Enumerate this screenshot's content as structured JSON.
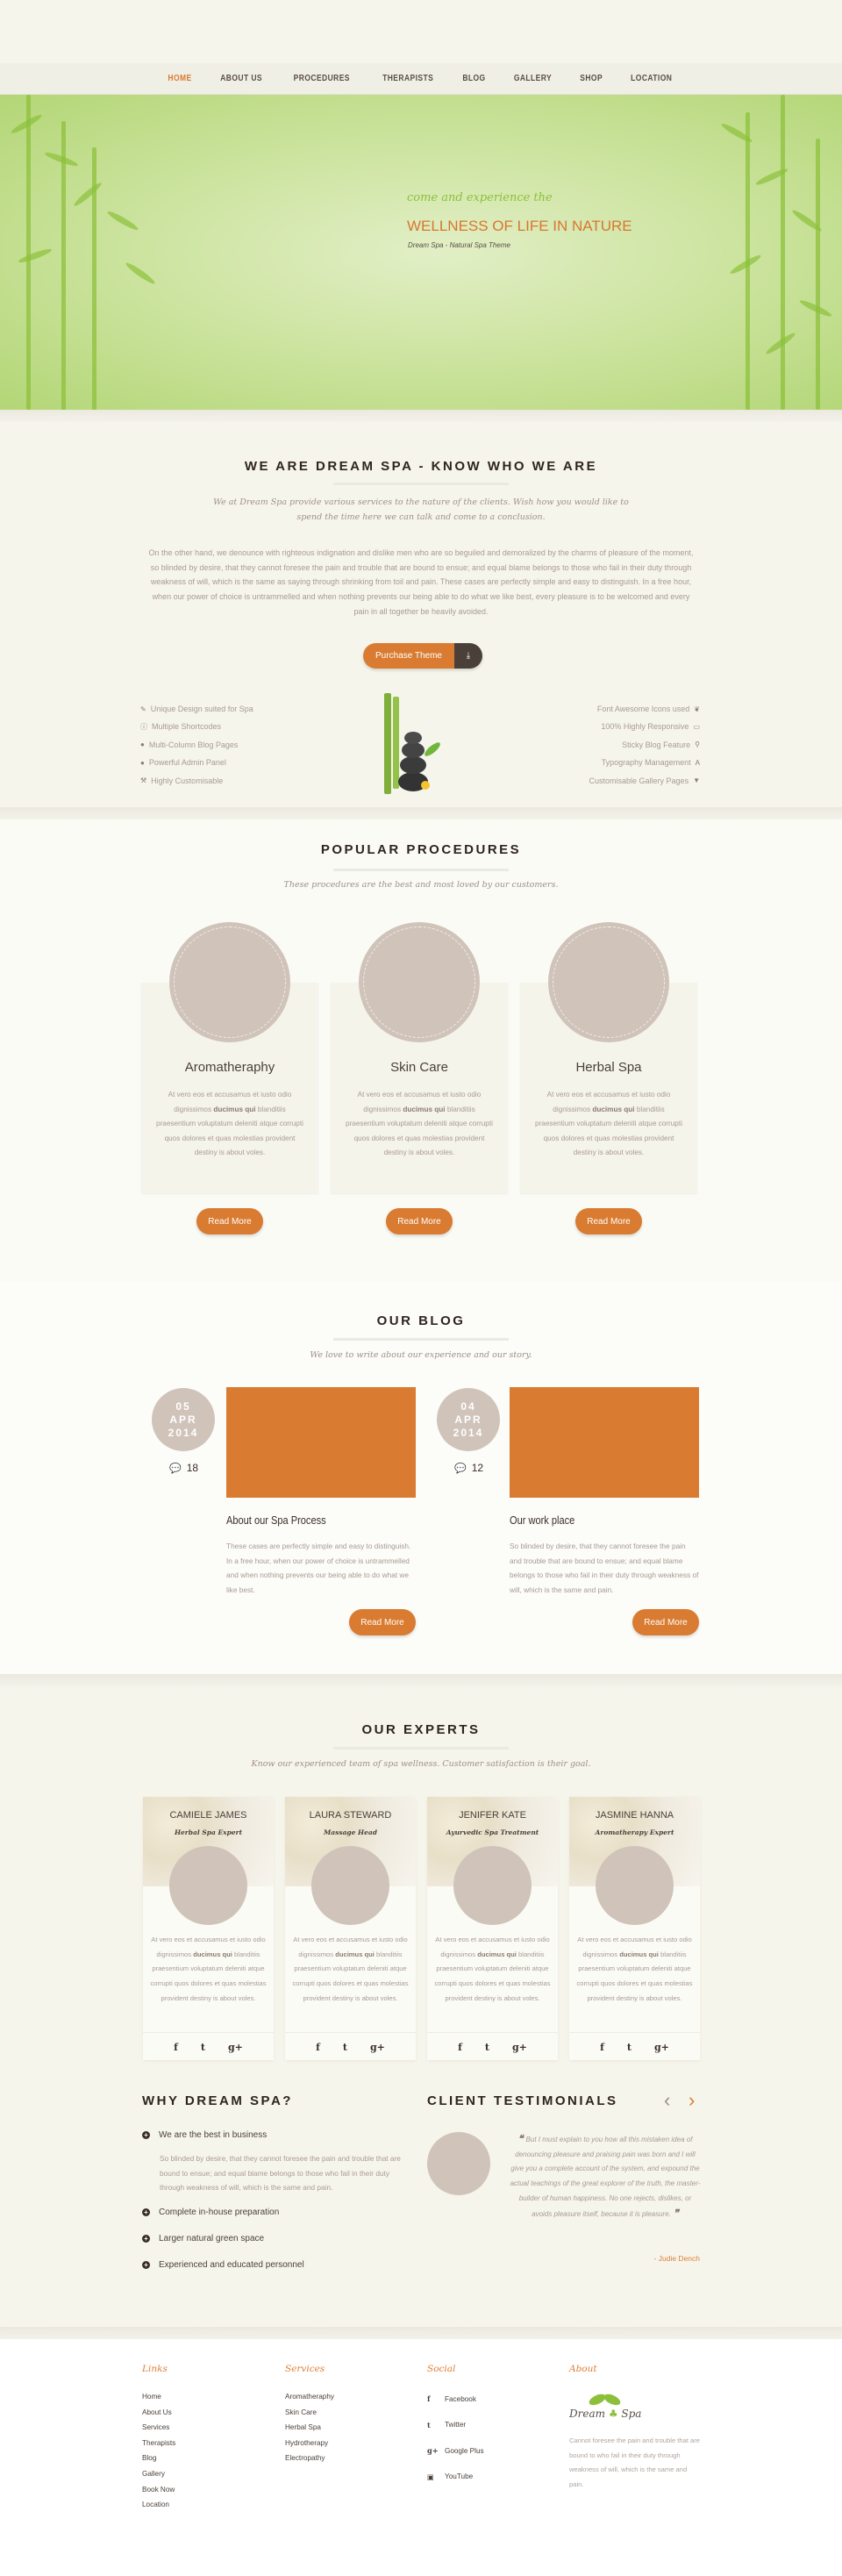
{
  "colors": {
    "accent": "#d97b31",
    "hero_green": "#c9e29a",
    "placeholder": "#d0c3ba"
  },
  "nav": {
    "items": [
      {
        "label": "HOME",
        "active": true
      },
      {
        "label": "ABOUT US"
      },
      {
        "label": "PROCEDURES"
      },
      {
        "label": "THERAPISTS"
      },
      {
        "label": "BLOG"
      },
      {
        "label": "GALLERY"
      },
      {
        "label": "SHOP"
      },
      {
        "label": "LOCATION"
      }
    ]
  },
  "hero": {
    "tagline": "come and experience the",
    "title": "WELLNESS OF LIFE IN NATURE",
    "subtitle": "Dream Spa - Natural Spa Theme"
  },
  "about": {
    "title": "WE ARE DREAM SPA - KNOW WHO WE ARE",
    "lead": "We at Dream Spa provide various services to the nature of the clients. Wish how you would like to spend the time here we can talk and come to a conclusion.",
    "body": "On the other hand, we denounce with righteous indignation and dislike men who are so beguiled and demoralized by the charms of pleasure of the moment, so blinded by desire, that they cannot foresee the pain and trouble that are bound to ensue; and equal blame belongs to those who fail in their duty through weakness of will, which is the same as saying through shrinking from toil and pain. These cases are perfectly simple and easy to distinguish. In a free hour, when our power of choice is untrammelled and when nothing prevents our being able to do what we like best, every pleasure is to be welcomed and every pain in all together be heavily avoided.",
    "button": "Purchase Theme",
    "button_icon": "download-icon",
    "features_left": [
      {
        "label": "Unique Design suited for Spa",
        "icon": "pencil"
      },
      {
        "label": "Multiple Shortcodes",
        "icon": "info"
      },
      {
        "label": "Multi-Column Blog Pages",
        "icon": "comment"
      },
      {
        "label": "Powerful Admin Panel",
        "icon": "circle"
      },
      {
        "label": "Highly Customisable",
        "icon": "gavel"
      }
    ],
    "features_right": [
      {
        "label": "Font Awesome Icons used",
        "icon": "leaf"
      },
      {
        "label": "100% Highly Responsive",
        "icon": "laptop"
      },
      {
        "label": "Sticky Blog Feature",
        "icon": "pin"
      },
      {
        "label": "Typography Management",
        "icon": "font"
      },
      {
        "label": "Customisable Gallery Pages",
        "icon": "filter"
      }
    ]
  },
  "procedures": {
    "title": "POPULAR PROCEDURES",
    "subtitle": "These procedures are the best and most loved by our customers.",
    "items": [
      {
        "title": "Aromatheraphy",
        "text_a": "At vero eos et accusamus et iusto odio dignissimos ",
        "text_bold": "ducimus qui",
        "text_b": " blanditiis praesentium voluptatum deleniti atque corrupti quos dolores et quas molestias provident destiny is about voles.",
        "button": "Read More"
      },
      {
        "title": "Skin Care",
        "text_a": "At vero eos et accusamus et iusto odio dignissimos ",
        "text_bold": "ducimus qui",
        "text_b": " blanditiis praesentium voluptatum deleniti atque corrupti quos dolores et quas molestias provident destiny is about voles.",
        "button": "Read More"
      },
      {
        "title": "Herbal Spa",
        "text_a": "At vero eos et accusamus et iusto odio dignissimos ",
        "text_bold": "ducimus qui",
        "text_b": " blanditiis praesentium voluptatum deleniti atque corrupti quos dolores et quas molestias provident destiny is about voles.",
        "button": "Read More"
      }
    ]
  },
  "blog": {
    "title": "OUR BLOG",
    "subtitle": "We love to write about our experience and our story.",
    "posts": [
      {
        "day": "05",
        "month": "APR",
        "year": "2014",
        "comments": "18",
        "title": "About our Spa Process",
        "text": "These cases are perfectly simple and easy to distinguish. In a free hour, when our power of choice is untrammelled and when nothing prevents our being able to do what we like best.",
        "button": "Read More"
      },
      {
        "day": "04",
        "month": "APR",
        "year": "2014",
        "comments": "12",
        "title": "Our work place",
        "text": "So blinded by desire, that they cannot foresee the pain and trouble that are bound to ensue; and equal blame belongs to those who fail in their duty through weakness of will, which is the same and pain.",
        "button": "Read More"
      }
    ]
  },
  "experts": {
    "title": "OUR EXPERTS",
    "subtitle": "Know our experienced team of spa wellness. Customer satisfaction is their goal.",
    "items": [
      {
        "name": "CAMIELE JAMES",
        "role": "Herbal Spa Expert"
      },
      {
        "name": "LAURA STEWARD",
        "role": "Massage Head"
      },
      {
        "name": "JENIFER KATE",
        "role": "Ayurvedic Spa Treatment"
      },
      {
        "name": "JASMINE HANNA",
        "role": "Aromatherapy Expert"
      }
    ],
    "text_a": "At vero eos et accusamus et iusto odio dignissimos ",
    "text_bold": "ducimus qui",
    "text_b": " blanditiis praesentium voluptatum deleniti atque corrupti quos dolores et quas molestias provident destiny is about voles.",
    "social": {
      "facebook": "f",
      "twitter": "t",
      "google": "g+"
    }
  },
  "why": {
    "title": "WHY DREAM SPA?",
    "items": [
      "We are the best in business",
      "Complete in-house preparation",
      "Larger natural green space",
      "Experienced and educated personnel"
    ],
    "first_text": "So blinded by desire, that they cannot foresee the pain and trouble that are bound to ensue; and equal blame belongs to those who fail in their duty through weakness of will, which is the same and pain."
  },
  "testimonials": {
    "title": "CLIENT TESTIMONIALS",
    "prev": "‹",
    "next": "›",
    "quote": "But I must explain to you how all this mistaken idea of denouncing pleasure and praising pain was born and I will give you a complete account of the system, and expound the actual teachings of the great explorer of the truth, the master-builder of human happiness. No one rejects, dislikes, or avoids pleasure itself, because it is pleasure.",
    "author": "- Judie Dench"
  },
  "footer": {
    "links": {
      "title": "Links",
      "items": [
        "Home",
        "About Us",
        "Services",
        "Therapists",
        "Blog",
        "Gallery",
        "Book Now",
        "Location"
      ]
    },
    "services": {
      "title": "Services",
      "items": [
        "Aromatheraphy",
        "Skin Care",
        "Herbal Spa",
        "Hydrotherapy",
        "Electropathy"
      ]
    },
    "social": {
      "title": "Social",
      "items": [
        {
          "label": "Facebook",
          "glyph": "f"
        },
        {
          "label": "Twitter",
          "glyph": "t"
        },
        {
          "label": "Google Plus",
          "glyph": "g+"
        },
        {
          "label": "YouTube",
          "glyph": "▣"
        }
      ]
    },
    "about": {
      "title": "About",
      "logo": "Dream Spa",
      "text": "Cannot foresee the pain and trouble that are bound to who fail in their duty through weakness of will, which is the same and pain."
    }
  }
}
